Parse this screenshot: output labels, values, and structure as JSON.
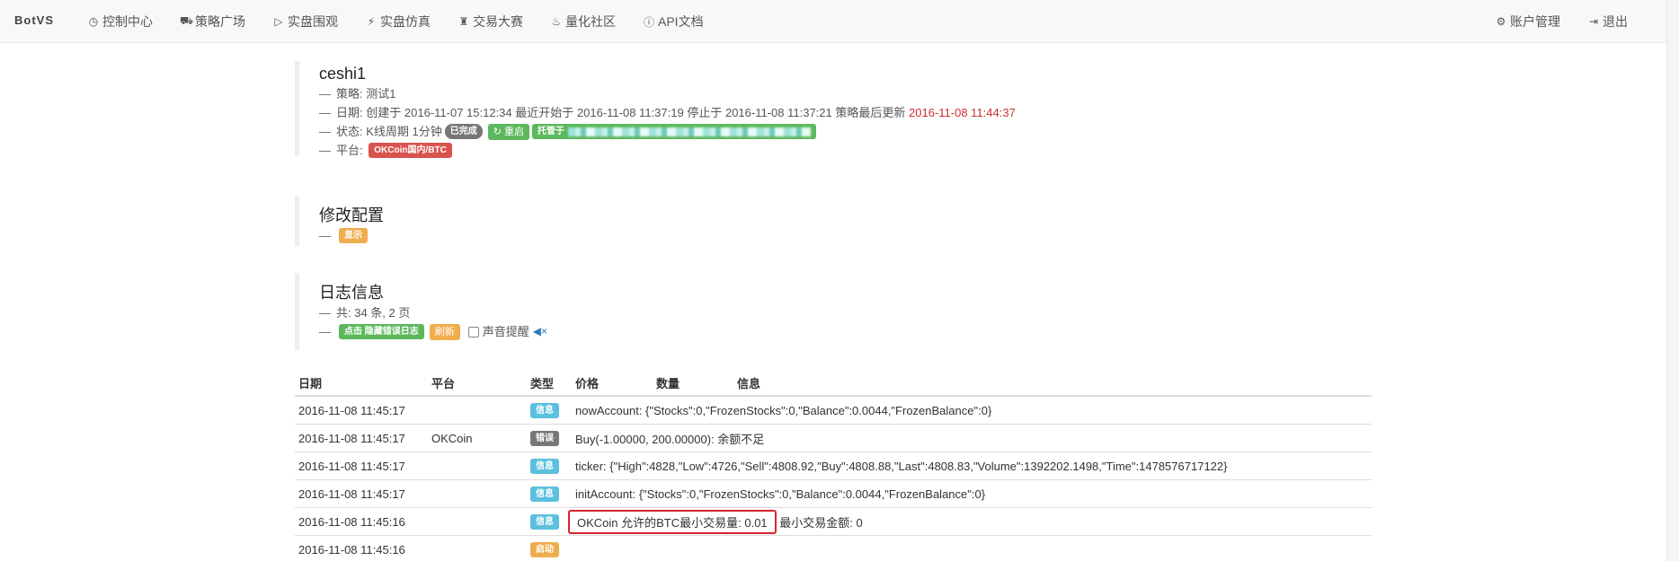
{
  "nav": {
    "brand": "BotVS",
    "left": [
      {
        "icon": "clock-icon",
        "glyph": "◷",
        "label": "控制中心"
      },
      {
        "icon": "cart-icon",
        "glyph": "⛟",
        "label": "策略广场"
      },
      {
        "icon": "play-circle-icon",
        "glyph": "▷",
        "label": "实盘围观"
      },
      {
        "icon": "flash-icon",
        "glyph": "⚡",
        "label": "实盘仿真"
      },
      {
        "icon": "trophy-icon",
        "glyph": "♜",
        "label": "交易大赛"
      },
      {
        "icon": "fire-icon",
        "glyph": "♨",
        "label": "量化社区"
      },
      {
        "icon": "info-icon",
        "glyph": "ⓘ",
        "label": "API文档"
      }
    ],
    "right": [
      {
        "icon": "gear-icon",
        "glyph": "⚙",
        "label": "账户管理"
      },
      {
        "icon": "logout-icon",
        "glyph": "⇥",
        "label": "退出"
      }
    ]
  },
  "robot": {
    "name": "ceshi1",
    "strategy_prefix": "策略:",
    "strategy": "测试1",
    "date_prefix": "日期:",
    "created_label": "创建于",
    "created": "2016-11-07 15:12:34",
    "started_label": "最近开始于",
    "started": "2016-11-08 11:37:19",
    "stopped_label": "停止于",
    "stopped": "2016-11-08 11:37:21",
    "updated_label": "策略最后更新",
    "updated": "2016-11-08 11:44:37",
    "status_prefix": "状态:",
    "status_text": "K线周期 1分钟",
    "status_badge": "已完成",
    "restart_label": "重启",
    "hosted_label": "托管于",
    "platform_prefix": "平台:",
    "platform": "OKCoin国内/BTC"
  },
  "config": {
    "title": "修改配置",
    "show_label": "显示"
  },
  "logs": {
    "title": "日志信息",
    "count_text": "共: 34 条, 2 页",
    "hide_errors_label": "点击 隐藏错误日志",
    "refresh_label": "刷新",
    "sound_label": "声音提醒"
  },
  "table": {
    "headers": {
      "date": "日期",
      "platform": "平台",
      "type": "类型",
      "price": "价格",
      "qty": "数量",
      "info": "信息"
    },
    "rows": [
      {
        "date": "2016-11-08 11:45:17",
        "platform": "",
        "type": "信息",
        "type_color": "#5bc0de",
        "info": "nowAccount: {\"Stocks\":0,\"FrozenStocks\":0,\"Balance\":0.0044,\"FrozenBalance\":0}"
      },
      {
        "date": "2016-11-08 11:45:17",
        "platform": "OKCoin",
        "type": "错误",
        "type_color": "#777777",
        "info": "Buy(-1.00000, 200.00000): 余额不足"
      },
      {
        "date": "2016-11-08 11:45:17",
        "platform": "",
        "type": "信息",
        "type_color": "#5bc0de",
        "info": "ticker: {\"High\":4828,\"Low\":4726,\"Sell\":4808.92,\"Buy\":4808.88,\"Last\":4808.83,\"Volume\":1392202.1498,\"Time\":1478576717122}"
      },
      {
        "date": "2016-11-08 11:45:17",
        "platform": "",
        "type": "信息",
        "type_color": "#5bc0de",
        "info": "initAccount: {\"Stocks\":0,\"FrozenStocks\":0,\"Balance\":0.0044,\"FrozenBalance\":0}"
      },
      {
        "date": "2016-11-08 11:45:16",
        "platform": "",
        "type": "信息",
        "type_color": "#5bc0de",
        "info_highlight": "OKCoin 允许的BTC最小交易量:   0.01",
        "info_rest": " 最小交易金额:   0"
      },
      {
        "date": "2016-11-08 11:45:16",
        "platform": "",
        "type": "启动",
        "type_color": "#f0ad4e",
        "info": ""
      }
    ]
  }
}
